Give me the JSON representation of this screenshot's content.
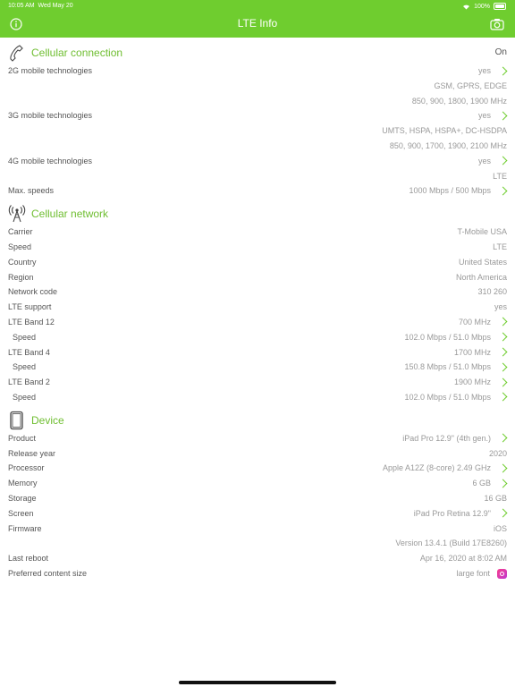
{
  "status": {
    "time": "10:05 AM",
    "date": "Wed May 20",
    "battery": "100%"
  },
  "header": {
    "title": "LTE Info"
  },
  "sections": {
    "cellular_connection": {
      "title": "Cellular connection",
      "value": "On",
      "rows": [
        {
          "label": "2G mobile technologies",
          "value": "yes",
          "chevron": true
        },
        {
          "label": "",
          "value": "GSM, GPRS, EDGE",
          "chevron": false
        },
        {
          "label": "",
          "value": "850, 900, 1800, 1900 MHz",
          "chevron": false
        },
        {
          "label": "3G mobile technologies",
          "value": "yes",
          "chevron": true
        },
        {
          "label": "",
          "value": "UMTS, HSPA, HSPA+, DC-HSDPA",
          "chevron": false
        },
        {
          "label": "",
          "value": "850, 900, 1700, 1900, 2100 MHz",
          "chevron": false
        },
        {
          "label": "4G mobile technologies",
          "value": "yes",
          "chevron": true
        },
        {
          "label": "",
          "value": "LTE",
          "chevron": false
        },
        {
          "label": "Max. speeds",
          "value": "1000 Mbps / 500 Mbps",
          "chevron": true
        }
      ]
    },
    "cellular_network": {
      "title": "Cellular network",
      "rows": [
        {
          "label": "Carrier",
          "value": "T-Mobile USA",
          "chevron": false
        },
        {
          "label": "Speed",
          "value": "LTE",
          "chevron": false
        },
        {
          "label": "Country",
          "value": "United States",
          "chevron": false
        },
        {
          "label": "Region",
          "value": "North America",
          "chevron": false
        },
        {
          "label": "Network code",
          "value": "310 260",
          "chevron": false
        },
        {
          "label": "LTE support",
          "value": "yes",
          "chevron": false
        },
        {
          "label": "LTE Band 12",
          "value": "700 MHz",
          "chevron": true
        },
        {
          "label": "Speed",
          "value": "102.0 Mbps / 51.0 Mbps",
          "chevron": true,
          "indent": true
        },
        {
          "label": "LTE Band 4",
          "value": "1700 MHz",
          "chevron": true
        },
        {
          "label": "Speed",
          "value": "150.8 Mbps / 51.0 Mbps",
          "chevron": true,
          "indent": true
        },
        {
          "label": "LTE Band 2",
          "value": "1900 MHz",
          "chevron": true
        },
        {
          "label": "Speed",
          "value": "102.0 Mbps / 51.0 Mbps",
          "chevron": true,
          "indent": true
        }
      ]
    },
    "device": {
      "title": "Device",
      "rows": [
        {
          "label": "Product",
          "value": "iPad Pro 12.9\" (4th gen.)",
          "chevron": true
        },
        {
          "label": "Release year",
          "value": "2020",
          "chevron": false
        },
        {
          "label": "Processor",
          "value": "Apple A12Z (8-core) 2.49 GHz",
          "chevron": true
        },
        {
          "label": "Memory",
          "value": "6 GB",
          "chevron": true
        },
        {
          "label": "Storage",
          "value": "16 GB",
          "chevron": false
        },
        {
          "label": "Screen",
          "value": "iPad Pro Retina 12.9\"",
          "chevron": true
        },
        {
          "label": "Firmware",
          "value": "iOS",
          "chevron": false
        },
        {
          "label": "",
          "value": "Version 13.4.1 (Build 17E8260)",
          "chevron": false
        },
        {
          "label": "Last reboot",
          "value": "Apr 16, 2020 at 8:02 AM",
          "chevron": false
        },
        {
          "label": "Preferred content size",
          "value": "large font",
          "chevron": false,
          "app_icon": true
        }
      ]
    }
  },
  "icons": {
    "info": "info-icon",
    "camera": "camera-icon",
    "phone": "phone-icon",
    "antenna": "antenna-icon",
    "tablet": "tablet-icon"
  },
  "colors": {
    "accent": "#6fcd2f",
    "section_title": "#6fbe31",
    "value_text": "#999999",
    "label_text": "#555555"
  }
}
